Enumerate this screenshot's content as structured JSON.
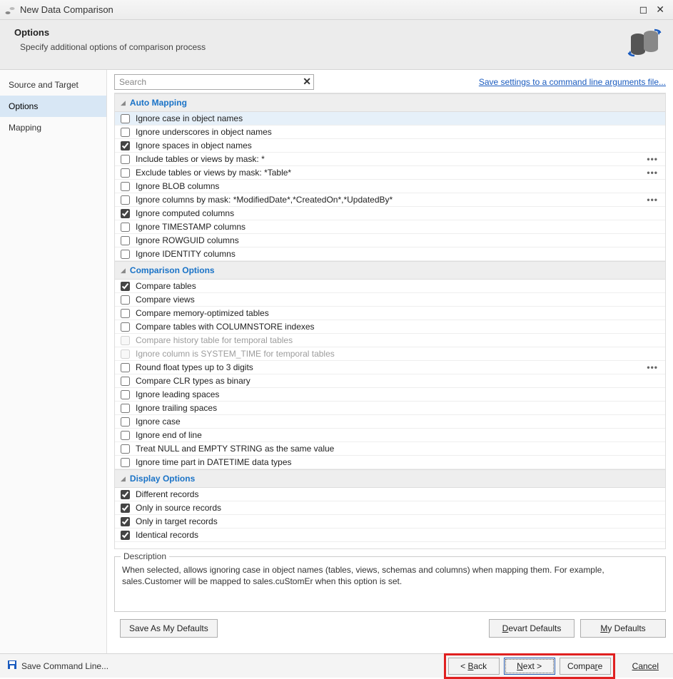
{
  "window": {
    "title": "New Data Comparison"
  },
  "header": {
    "title": "Options",
    "subtitle": "Specify additional options of comparison process"
  },
  "sidebar": {
    "items": [
      {
        "label": "Source and Target"
      },
      {
        "label": "Options"
      },
      {
        "label": "Mapping"
      }
    ]
  },
  "toprow": {
    "search_placeholder": "Search",
    "save_link": "Save settings to a command line arguments file..."
  },
  "groups": [
    {
      "title": "Auto Mapping",
      "options": [
        {
          "label": "Ignore case in object names",
          "checked": false,
          "highlighted": true
        },
        {
          "label": "Ignore underscores in object names",
          "checked": false
        },
        {
          "label": "Ignore spaces in object names",
          "checked": true
        },
        {
          "label": "Include tables or views by mask: *",
          "checked": false,
          "more": true
        },
        {
          "label": "Exclude tables or views by mask: *Table*",
          "checked": false,
          "more": true
        },
        {
          "label": "Ignore BLOB columns",
          "checked": false
        },
        {
          "label": "Ignore columns by mask: *ModifiedDate*,*CreatedOn*,*UpdatedBy*",
          "checked": false,
          "more": true
        },
        {
          "label": "Ignore computed columns",
          "checked": true
        },
        {
          "label": "Ignore TIMESTAMP columns",
          "checked": false
        },
        {
          "label": "Ignore ROWGUID columns",
          "checked": false
        },
        {
          "label": "Ignore IDENTITY columns",
          "checked": false
        }
      ]
    },
    {
      "title": "Comparison Options",
      "options": [
        {
          "label": "Compare tables",
          "checked": true
        },
        {
          "label": "Compare views",
          "checked": false
        },
        {
          "label": "Compare memory-optimized tables",
          "checked": false
        },
        {
          "label": "Compare tables with COLUMNSTORE indexes",
          "checked": false
        },
        {
          "label": "Compare history table for temporal tables",
          "checked": false,
          "disabled": true
        },
        {
          "label": "Ignore column is SYSTEM_TIME for temporal tables",
          "checked": false,
          "disabled": true
        },
        {
          "label": "Round float types up to 3 digits",
          "checked": false,
          "more": true
        },
        {
          "label": "Compare CLR types as binary",
          "checked": false
        },
        {
          "label": "Ignore leading spaces",
          "checked": false
        },
        {
          "label": "Ignore trailing spaces",
          "checked": false
        },
        {
          "label": "Ignore case",
          "checked": false
        },
        {
          "label": "Ignore end of line",
          "checked": false
        },
        {
          "label": "Treat NULL and EMPTY STRING as the same value",
          "checked": false
        },
        {
          "label": "Ignore time part in DATETIME data types",
          "checked": false
        }
      ]
    },
    {
      "title": "Display Options",
      "options": [
        {
          "label": "Different records",
          "checked": true
        },
        {
          "label": "Only in source records",
          "checked": true
        },
        {
          "label": "Only in target records",
          "checked": true
        },
        {
          "label": "Identical records",
          "checked": true
        }
      ]
    }
  ],
  "description": {
    "legend": "Description",
    "body": "When selected, allows ignoring case in object names (tables, views, schemas and columns) when mapping them. For example, sales.Customer will be mapped to sales.cuStomEr when this option is set."
  },
  "defaults": {
    "save_my": "Save As My Defaults",
    "devart": "Devart Defaults",
    "my": "My Defaults"
  },
  "footer": {
    "save_cl": "Save Command Line...",
    "back": "Back",
    "next": "Next",
    "compare": "Compare",
    "cancel": "Cancel"
  }
}
